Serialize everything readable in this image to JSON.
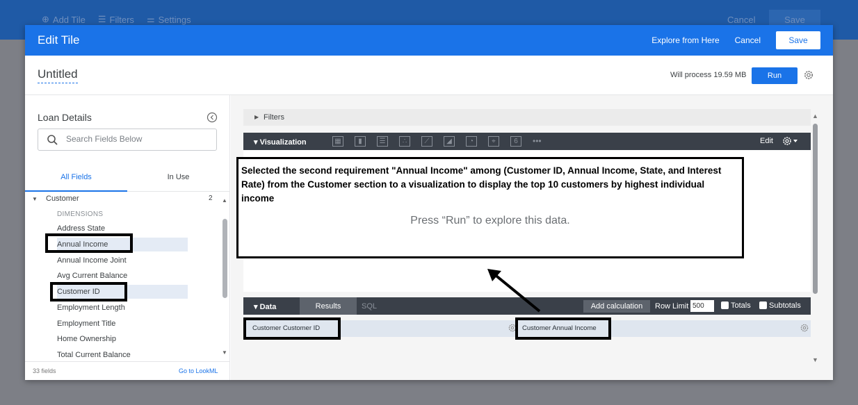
{
  "background": {
    "toolbar": [
      "Add Tile",
      "Filters",
      "Settings"
    ],
    "cancel": "Cancel",
    "save": "Save"
  },
  "modal": {
    "title": "Edit Tile",
    "explore_link": "Explore from Here",
    "cancel": "Cancel",
    "save": "Save",
    "tile_title": "Untitled",
    "process_text": "Will process 19.59 MB",
    "run": "Run"
  },
  "left_panel": {
    "explore_name": "Loan Details",
    "search_placeholder": "Search Fields Below",
    "tabs": {
      "all": "All Fields",
      "in_use": "In Use"
    },
    "section": {
      "name": "Customer",
      "count": "2"
    },
    "dimensions_label": "DIMENSIONS",
    "fields": [
      "Address State",
      "Annual Income",
      "Annual Income Joint",
      "Avg Current Balance",
      "Customer ID",
      "Employment Length",
      "Employment Title",
      "Home Ownership",
      "Total Current Balance"
    ],
    "footer": {
      "count": "33 fields",
      "lookml": "Go to LookML"
    }
  },
  "right_panel": {
    "filters": "Filters",
    "visualization": "Visualization",
    "viz_icons": [
      "table-icon",
      "bar-chart-icon",
      "column-icon",
      "scatter-icon",
      "line-icon",
      "area-icon",
      "pie-icon",
      "map-icon",
      "single-value-icon"
    ],
    "single_value_glyph": "6",
    "more": "•••",
    "edit": "Edit",
    "press_run": "Press “Run” to explore this data.",
    "data": "Data",
    "results": "Results",
    "sql": "SQL",
    "add_calculation": "Add calculation",
    "row_limit": "Row Limit",
    "row_limit_value": "500",
    "totals": "Totals",
    "subtotals": "Subtotals",
    "columns": [
      "Customer Customer ID",
      "Customer Annual Income"
    ]
  },
  "annotation": {
    "text": "Selected the second requirement \"Annual Income\" among (Customer ID, Annual Income, State, and Interest Rate) from the Customer section to a visualization to display the top 10 customers by highest individual income"
  },
  "colors": {
    "header_blue": "#1a73e8",
    "dark_bar": "#3a4049",
    "annotation": "#000000"
  }
}
